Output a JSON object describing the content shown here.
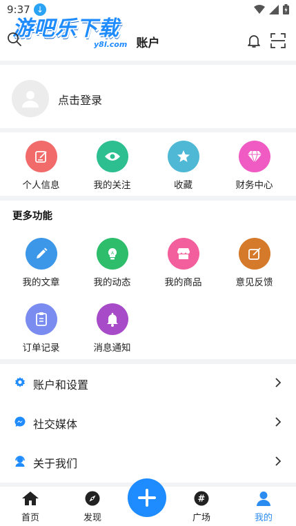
{
  "status_bar": {
    "time": "9:37"
  },
  "header": {
    "title": "账户",
    "logo_text": "游吧乐下载",
    "logo_sub": "y8l.com"
  },
  "login": {
    "label": "点击登录"
  },
  "quick": [
    {
      "label": "个人信息",
      "icon": "edit-icon",
      "color": "#f26b6b"
    },
    {
      "label": "我的关注",
      "icon": "eye-icon",
      "color": "#2ebf91"
    },
    {
      "label": "收藏",
      "icon": "star-icon",
      "color": "#4fb8d4"
    },
    {
      "label": "财务中心",
      "icon": "diamond-icon",
      "color": "#ef5bc3"
    }
  ],
  "more": {
    "title": "更多功能",
    "items": [
      {
        "label": "我的文章",
        "icon": "pencil-icon",
        "color": "#3d97e8"
      },
      {
        "label": "我的动态",
        "icon": "lightbulb-icon",
        "color": "#2ebd6b"
      },
      {
        "label": "我的商品",
        "icon": "shop-icon",
        "color": "#f25f9c"
      },
      {
        "label": "意见反馈",
        "icon": "feedback-icon",
        "color": "#d47a2a"
      },
      {
        "label": "订单记录",
        "icon": "clipboard-icon",
        "color": "#7b8cf0"
      },
      {
        "label": "消息通知",
        "icon": "bell-icon",
        "color": "#a74bc8"
      }
    ]
  },
  "settings": [
    {
      "label": "账户和设置",
      "icon": "gear-icon"
    },
    {
      "label": "社交媒体",
      "icon": "messenger-icon"
    },
    {
      "label": "关于我们",
      "icon": "support-icon"
    }
  ],
  "tabs": [
    {
      "label": "首页",
      "icon": "home-icon"
    },
    {
      "label": "发现",
      "icon": "compass-icon"
    },
    {
      "label": "广场",
      "icon": "hashtag-icon"
    },
    {
      "label": "我的",
      "icon": "user-icon"
    }
  ],
  "colors": {
    "accent": "#1e8bff",
    "active_tab": "#2a8cf0"
  }
}
